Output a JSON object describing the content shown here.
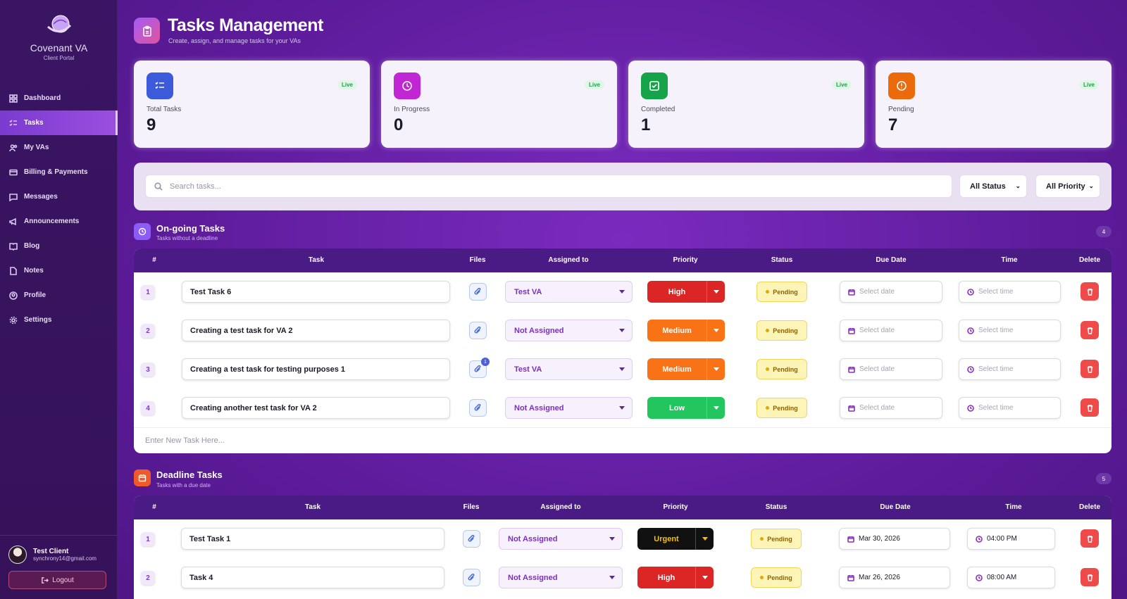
{
  "app": {
    "brand": "Covenant VA",
    "brand_sub": "Client Portal"
  },
  "nav": [
    {
      "label": "Dashboard",
      "icon": "dashboard-icon"
    },
    {
      "label": "Tasks",
      "icon": "tasks-icon",
      "active": true
    },
    {
      "label": "My VAs",
      "icon": "users-icon"
    },
    {
      "label": "Billing & Payments",
      "icon": "card-icon"
    },
    {
      "label": "Messages",
      "icon": "message-icon"
    },
    {
      "label": "Announcements",
      "icon": "megaphone-icon"
    },
    {
      "label": "Blog",
      "icon": "book-icon"
    },
    {
      "label": "Notes",
      "icon": "note-icon"
    },
    {
      "label": "Profile",
      "icon": "profile-icon"
    },
    {
      "label": "Settings",
      "icon": "gear-icon"
    }
  ],
  "user": {
    "name": "Test Client",
    "email": "synchrony14@gmail.com",
    "logout": "Logout"
  },
  "header": {
    "title": "Tasks Management",
    "subtitle": "Create, assign, and manage tasks for your VAs"
  },
  "stats": [
    {
      "label": "Total Tasks",
      "value": "9",
      "live": "Live",
      "color": "#3b5bdb"
    },
    {
      "label": "In Progress",
      "value": "0",
      "live": "Live",
      "color": "#c026d3"
    },
    {
      "label": "Completed",
      "value": "1",
      "live": "Live",
      "color": "#16a34a"
    },
    {
      "label": "Pending",
      "value": "7",
      "live": "Live",
      "color": "#ea6a0c"
    }
  ],
  "filters": {
    "search_placeholder": "Search tasks...",
    "status": "All Status",
    "priority": "All Priority"
  },
  "columns": {
    "num": "#",
    "task": "Task",
    "files": "Files",
    "assigned": "Assigned to",
    "priority": "Priority",
    "status": "Status",
    "due": "Due Date",
    "time": "Time",
    "delete": "Delete"
  },
  "ongoing": {
    "title": "On-going Tasks",
    "subtitle": "Tasks without a deadline",
    "count": "4",
    "new_task_placeholder": "Enter New Task Here...",
    "rows": [
      {
        "n": "1",
        "task": "Test Task 6",
        "assigned": "Test VA",
        "priority": "High",
        "status": "Pending",
        "date": "Select date",
        "time": "Select time"
      },
      {
        "n": "2",
        "task": "Creating a test task for VA 2",
        "assigned": "Not Assigned",
        "priority": "Medium",
        "status": "Pending",
        "date": "Select date",
        "time": "Select time"
      },
      {
        "n": "3",
        "task": "Creating a test task for testing purposes 1",
        "assigned": "Test VA",
        "priority": "Medium",
        "status": "Pending",
        "date": "Select date",
        "time": "Select time",
        "files": "1"
      },
      {
        "n": "4",
        "task": "Creating another test task for VA 2",
        "assigned": "Not Assigned",
        "priority": "Low",
        "status": "Pending",
        "date": "Select date",
        "time": "Select time"
      }
    ]
  },
  "deadline": {
    "title": "Deadline Tasks",
    "subtitle": "Tasks with a due date",
    "count": "5",
    "rows": [
      {
        "n": "1",
        "task": "Test Task 1",
        "assigned": "Not Assigned",
        "priority": "Urgent",
        "status": "Pending",
        "date": "Mar 30, 2026",
        "time": "04:00 PM"
      },
      {
        "n": "2",
        "task": "Task 4",
        "assigned": "Not Assigned",
        "priority": "High",
        "status": "Pending",
        "date": "Mar 26, 2026",
        "time": "08:00 AM"
      }
    ]
  },
  "colors": {
    "high": "#dc2626",
    "medium": "#f97316",
    "low": "#22c55e",
    "urgent": "#111111",
    "accent": "#7b3ad0"
  }
}
